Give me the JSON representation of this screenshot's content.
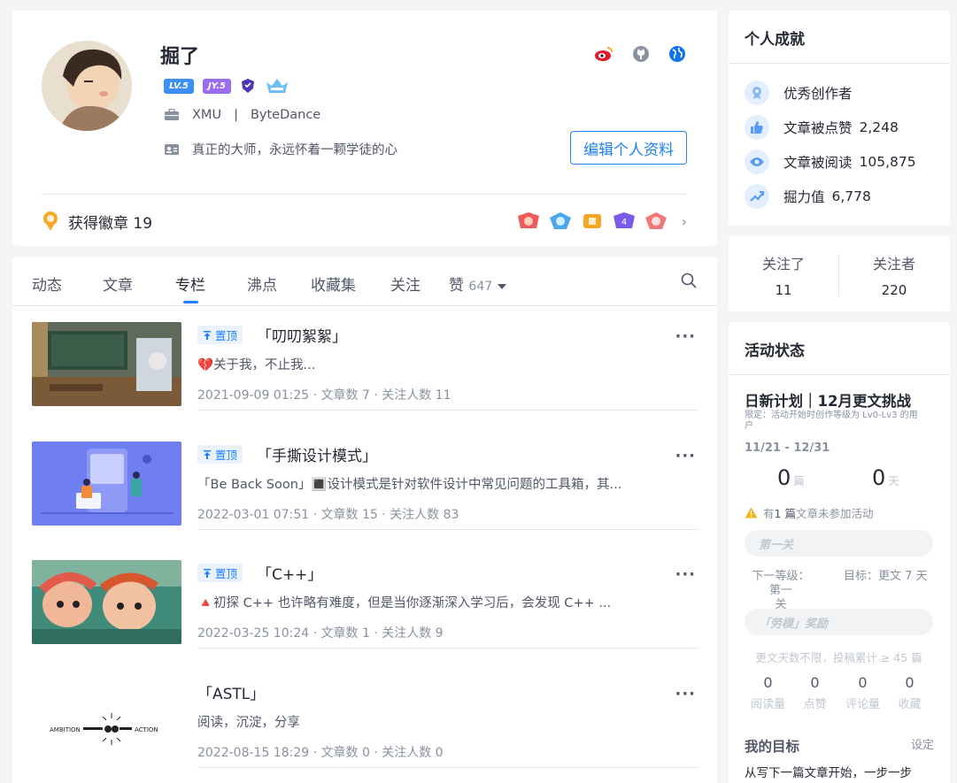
{
  "profile": {
    "name": "掘了",
    "level_badges": [
      "LV.5",
      "JY.5"
    ],
    "school": "XMU",
    "separator": "|",
    "company": "ByteDance",
    "bio": "真正的大师，永远怀着一颗学徒的心",
    "edit_button": "编辑个人资料",
    "social_icons": [
      "weibo-icon",
      "github-icon",
      "globe-icon"
    ],
    "medals_label": "获得徽章 19"
  },
  "tabs": [
    {
      "label": "动态"
    },
    {
      "label": "文章"
    },
    {
      "label": "专栏",
      "active": true
    },
    {
      "label": "沸点"
    },
    {
      "label": "收藏集"
    },
    {
      "label": "关注"
    },
    {
      "label": "赞",
      "count": "647"
    }
  ],
  "columns": [
    {
      "pinned": true,
      "pin_label": "置顶",
      "title": "「叨叨絮絮」",
      "desc": "💔关于我，不止我...",
      "meta": "2021-09-09 01:25 · 文章数 7 · 关注人数 11"
    },
    {
      "pinned": true,
      "pin_label": "置顶",
      "title": "「手撕设计模式」",
      "desc": "「Be Back Soon」🔳设计模式是针对软件设计中常见问题的工具箱，其...",
      "meta": "2022-03-01 07:51 · 文章数 15 · 关注人数 83"
    },
    {
      "pinned": true,
      "pin_label": "置顶",
      "title": "「C++」",
      "desc": "🔺初探 C++ 也许略有难度，但是当你逐渐深入学习后，会发现 C++ ...",
      "meta": "2022-03-25 10:24 · 文章数 1 · 关注人数 9"
    },
    {
      "pinned": false,
      "title": "「ASTL」",
      "desc": "阅读，沉淀，分享",
      "meta": "2022-08-15 18:29 · 文章数 0 · 关注人数 0",
      "thumb_text_left": "AMBITION",
      "thumb_text_right": "ACTION"
    }
  ],
  "achievements": {
    "title": "个人成就",
    "items": [
      {
        "label": "优秀创作者",
        "value": "",
        "icon": "medal-icon"
      },
      {
        "label": "文章被点赞",
        "value": "2,248",
        "icon": "thumb-up-icon"
      },
      {
        "label": "文章被阅读",
        "value": "105,875",
        "icon": "eye-icon"
      },
      {
        "label": "掘力值",
        "value": "6,778",
        "icon": "trend-icon"
      }
    ]
  },
  "follow": {
    "following_label": "关注了",
    "following": "11",
    "followers_label": "关注者",
    "followers": "220"
  },
  "activity": {
    "title": "活动状态",
    "event": "日新计划｜12月更文挑战",
    "limit_line1": "限定：活动开始时创作等级为 Lv0-Lv3 的用",
    "limit_line2": "户",
    "dates": "11/21 - 12/31",
    "posts": "0",
    "posts_unit": "篇",
    "days": "0",
    "days_unit": "天",
    "warn_pre": "有",
    "warn_bold": "1 篇",
    "warn_post": "文章未参加活动",
    "stage_pill": "第一关",
    "next_level_line1": "下一等级：第一",
    "next_level_line2": "关",
    "target": "目标：更文 7 天",
    "reward_pill": "「劳模」奖励",
    "reward_rule": "更文天数不限，投稿累计 ≥ 45 篇",
    "stats": [
      {
        "value": "0",
        "label": "阅读量"
      },
      {
        "value": "0",
        "label": "点赞"
      },
      {
        "value": "0",
        "label": "评论量"
      },
      {
        "value": "0",
        "label": "收藏"
      }
    ],
    "goal_title": "我的目标",
    "goal_set": "设定",
    "goal_desc": "从写下一篇文章开始，一步一步"
  },
  "colors": {
    "accent": "#1e80ff",
    "text": "#252933",
    "muted": "#8a919f",
    "bg": "#f4f5f5"
  }
}
